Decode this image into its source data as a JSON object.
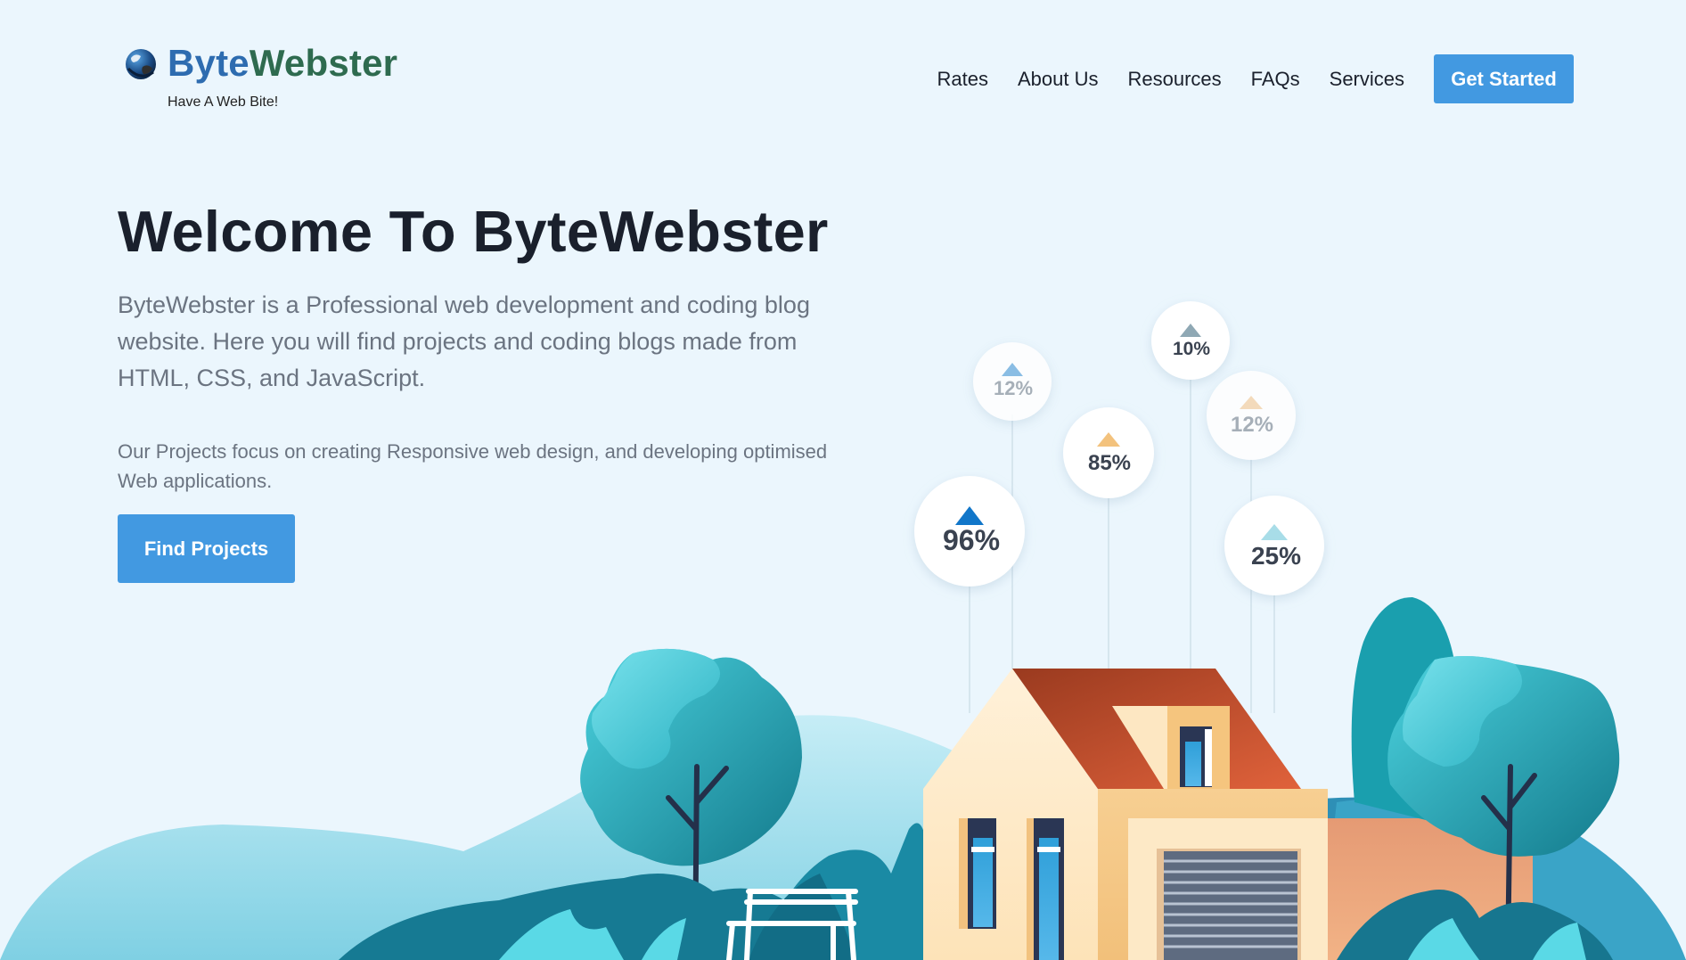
{
  "brand": {
    "name_part1": "Byte",
    "name_part2": "Webster",
    "tagline": "Have A Web Bite!",
    "logo_icon": "globe-icon"
  },
  "nav": {
    "items": [
      "Rates",
      "About Us",
      "Resources",
      "FAQs",
      "Services"
    ],
    "cta_label": "Get Started"
  },
  "hero": {
    "title": "Welcome To ByteWebster",
    "lead": "ByteWebster is a Professional web development and coding blog website. Here you will find projects and coding blogs made from HTML, CSS, and JavaScript.",
    "sub": "Our Projects focus on creating Responsive web design, and developing optimised Web applications.",
    "button_label": "Find Projects"
  },
  "stats": [
    {
      "label": "96%",
      "color": "#1176c9"
    },
    {
      "label": "12%",
      "color": "#7ab4e0"
    },
    {
      "label": "85%",
      "color": "#f3c27d"
    },
    {
      "label": "10%",
      "color": "#8fa8b4"
    },
    {
      "label": "12%",
      "color": "#f5d6b0"
    },
    {
      "label": "25%",
      "color": "#a8dde8"
    }
  ],
  "colors": {
    "accent": "#4299e1",
    "background": "#ebf6fd",
    "heading": "#1a202c",
    "body_text": "#6b7481",
    "roof": "#c2482a",
    "teal": "#1aa6b0"
  }
}
